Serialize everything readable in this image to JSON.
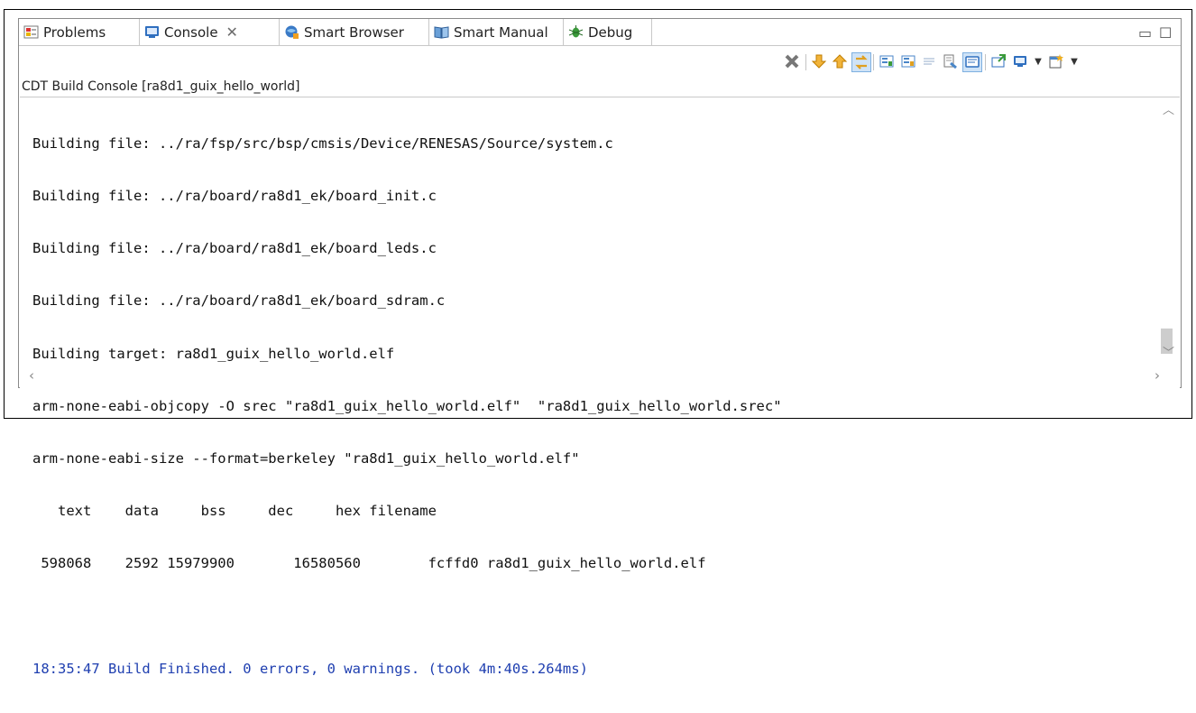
{
  "tabs": [
    {
      "label": "Problems",
      "icon": "problems-icon"
    },
    {
      "label": "Console",
      "icon": "console-icon",
      "active": true
    },
    {
      "label": "Smart Browser",
      "icon": "smart-browser-icon"
    },
    {
      "label": "Smart Manual",
      "icon": "smart-manual-icon"
    },
    {
      "label": "Debug",
      "icon": "debug-icon"
    }
  ],
  "console": {
    "title": "CDT Build Console [ra8d1_guix_hello_world]",
    "lines": [
      "Building file: ../ra/fsp/src/bsp/cmsis/Device/RENESAS/Source/system.c",
      "Building file: ../ra/board/ra8d1_ek/board_init.c",
      "Building file: ../ra/board/ra8d1_ek/board_leds.c",
      "Building file: ../ra/board/ra8d1_ek/board_sdram.c",
      "Building target: ra8d1_guix_hello_world.elf",
      "arm-none-eabi-objcopy -O srec \"ra8d1_guix_hello_world.elf\"  \"ra8d1_guix_hello_world.srec\"",
      "arm-none-eabi-size --format=berkeley \"ra8d1_guix_hello_world.elf\"",
      "   text    data     bss     dec     hex filename",
      " 598068    2592 15979900       16580560        fcffd0 ra8d1_guix_hello_world.elf",
      "",
      "18:35:47 Build Finished. 0 errors, 0 warnings. (took 4m:40s.264ms)"
    ]
  },
  "colors": {
    "finish_text": "#1f3fb0",
    "toolbar_orange": "#e8a317",
    "toolbar_blue": "#4a86c8",
    "toolbar_green": "#3a9a3a"
  }
}
